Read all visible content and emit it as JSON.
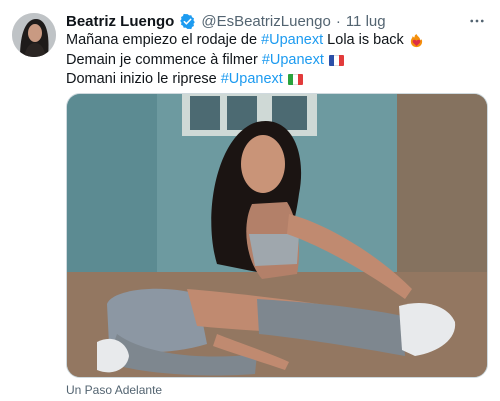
{
  "tweet": {
    "author_name": "Beatriz Luengo",
    "handle": "@EsBeatrizLuengo",
    "separator": "·",
    "time": "11 lug",
    "verified": true,
    "lines": [
      {
        "text_before": "Mañana empiezo el rodaje de ",
        "hashtag": "#Upanext",
        "text_after": " Lola is back",
        "emoji": "heart-on-fire"
      },
      {
        "text_before": "Demain je commence à filmer ",
        "hashtag": "#Upanext",
        "text_after": "",
        "emoji": "flag-france"
      },
      {
        "text_before": "Domani inizio le riprese ",
        "hashtag": "#Upanext",
        "text_after": "",
        "emoji": "flag-italy"
      }
    ],
    "media_caption": "Un Paso Adelante"
  },
  "colors": {
    "text": "#0f1419",
    "secondary": "#536471",
    "link": "#1d9bf0",
    "verified_badge": "#1d9bf0"
  },
  "icons": {
    "verified": "verified-badge-icon",
    "more": "more-dots-icon"
  }
}
